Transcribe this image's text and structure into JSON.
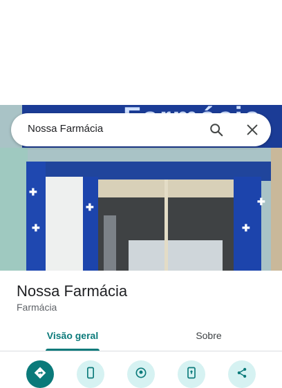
{
  "search": {
    "query": "Nossa Farmácia"
  },
  "photo": {
    "sign_text": "Farmácia"
  },
  "place": {
    "name": "Nossa Farmácia",
    "category": "Farmácia"
  },
  "tabs": [
    {
      "label": "Visão geral",
      "active": true
    },
    {
      "label": "Sobre",
      "active": false
    }
  ],
  "actions": [
    {
      "icon": "directions-icon"
    },
    {
      "icon": "phone-icon"
    },
    {
      "icon": "nearby-icon"
    },
    {
      "icon": "send-to-phone-icon"
    },
    {
      "icon": "share-icon"
    }
  ],
  "colors": {
    "accent": "#0b7a7a",
    "accent_light": "#d6f2f2",
    "text_primary": "#202124",
    "text_secondary": "#5f6368"
  }
}
